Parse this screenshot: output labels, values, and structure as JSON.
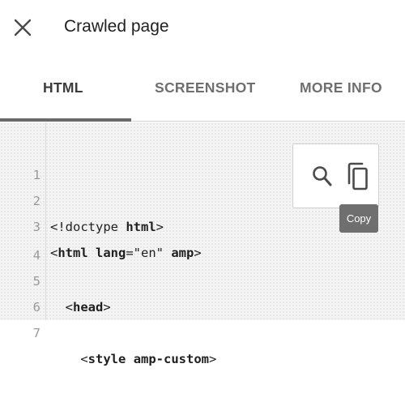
{
  "header": {
    "close_icon": "close-icon",
    "title": "Crawled page"
  },
  "tabs": [
    {
      "label": "HTML",
      "active": true
    },
    {
      "label": "SCREENSHOT",
      "active": false
    },
    {
      "label": "MORE INFO",
      "active": false
    }
  ],
  "code": {
    "lines": [
      {
        "number": "1",
        "text": ""
      },
      {
        "number": "2",
        "text": "<!doctype html>"
      },
      {
        "number": "3",
        "text": "<html lang=\"en\" amp>"
      },
      {
        "number": "4",
        "text": ""
      },
      {
        "number": "5",
        "text": "  <head>"
      },
      {
        "number": "6",
        "text": ""
      },
      {
        "number": "7",
        "text": "    <style amp-custom>"
      }
    ]
  },
  "actions": {
    "search_icon": "search-icon",
    "copy_icon": "copy-icon",
    "copy_tooltip": "Copy"
  },
  "colors": {
    "tab_indicator": "#6a6a6a",
    "code_background": "#f4f4f4",
    "tooltip_background": "#6f6f6f"
  }
}
